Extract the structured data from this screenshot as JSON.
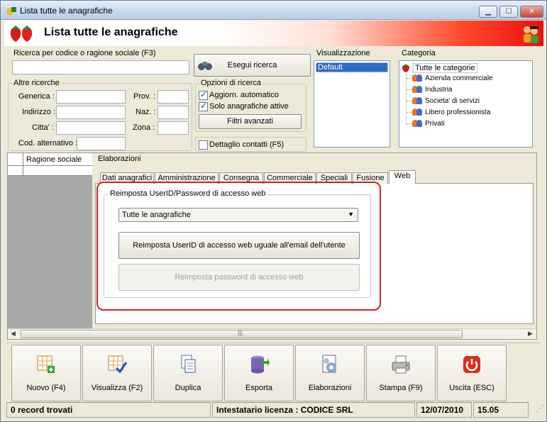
{
  "window": {
    "title": "Lista tutte le anagrafiche"
  },
  "header": {
    "title": "Lista tutte le anagrafiche"
  },
  "search": {
    "group_label": "Ricerca per codice o ragione sociale (F3)",
    "value": "",
    "button_label": "Esegui ricerca"
  },
  "other_search": {
    "group_label": "Altre ricerche",
    "fields": {
      "generica": "Generica :",
      "indirizzo": "Indirizzo :",
      "citta": "Citta' :",
      "cod_alternativo": "Cod. alternativo :",
      "prov": "Prov. :",
      "naz": "Naz. :",
      "zona": "Zona :"
    }
  },
  "options": {
    "group_label": "Opzioni di ricerca",
    "auto_update": "Aggiorn. automatico",
    "only_active": "Solo anagrafiche attive",
    "advanced_filters": "Filtri avanzati",
    "contact_detail": "Dettaglio contatti (F5)"
  },
  "view": {
    "group_label": "Visualizzazione",
    "items": [
      "Default"
    ]
  },
  "category": {
    "group_label": "Categoria",
    "root": "Tutte le categorie",
    "items": [
      "Azienda commerciale",
      "Industria",
      "Societa' di servizi",
      "Libero professionista",
      "Privati"
    ]
  },
  "grid": {
    "columns": [
      "Ragione sociale"
    ]
  },
  "elaborazioni": {
    "label": "Elaborazioni",
    "tabs": [
      "Dati anagrafici",
      "Amministrazione",
      "Consegna",
      "Commerciale",
      "Speciali",
      "Fusione",
      "Web"
    ],
    "active_tab": "Web",
    "web": {
      "group_label": "Reimposta UserID/Password di accesso web",
      "select_value": "Tutte le anagrafiche",
      "reset_userid": "Reimposta UserID di accesso web uguale all'email dell'utente",
      "reset_password": "Reimposta password di accesso web"
    }
  },
  "toolbar": {
    "new": "Nuovo (F4)",
    "view": "Visualizza (F2)",
    "duplicate": "Duplica",
    "export": "Esporta",
    "process": "Elaborazioni",
    "print": "Stampa (F9)",
    "exit": "Uscita (ESC)"
  },
  "statusbar": {
    "records": "0 record trovati",
    "license": "Intestatario licenza : CODICE SRL",
    "date": "12/07/2010",
    "time": "15.05"
  },
  "colors": {
    "highlight": "#316ac5",
    "annotation_red": "#d81e26"
  }
}
